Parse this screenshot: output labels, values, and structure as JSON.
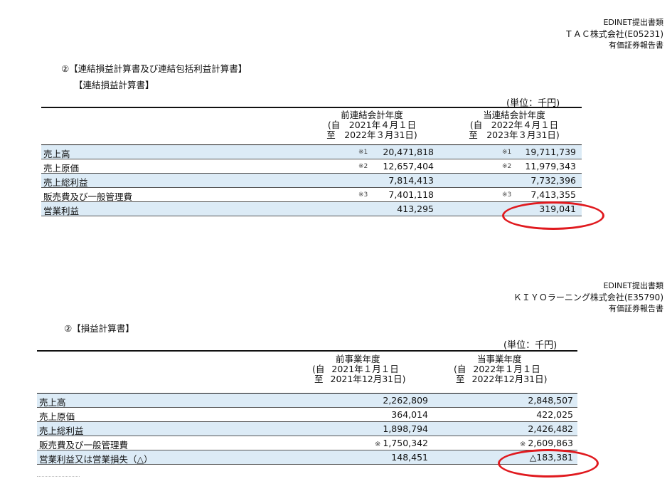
{
  "doc1": {
    "header": {
      "line1": "EDINET提出書類",
      "line2": "ＴＡＣ株式会社(E05231)",
      "line3": "有価証券報告書"
    },
    "section_title": "②【連結損益計算書及び連結包括利益計算書】",
    "sub_title": "【連結損益計算書】",
    "unit": "(単位：千円)",
    "col1": {
      "line1": "前連結会計年度",
      "line2": "(自　2021年４月１日",
      "line3": "至　2022年３月31日)"
    },
    "col2": {
      "line1": "当連結会計年度",
      "line2": "(自　2022年４月１日",
      "line3": "至　2023年３月31日)"
    },
    "rows": [
      {
        "label": "売上高",
        "mark1": "※1",
        "v1": "20,471,818",
        "mark2": "※1",
        "v2": "19,711,739"
      },
      {
        "label": "売上原価",
        "mark1": "※2",
        "v1": "12,657,404",
        "mark2": "※2",
        "v2": "11,979,343"
      },
      {
        "label": "売上総利益",
        "mark1": "",
        "v1": "7,814,413",
        "mark2": "",
        "v2": "7,732,396"
      },
      {
        "label": "販売費及び一般管理費",
        "mark1": "※3",
        "v1": "7,401,118",
        "mark2": "※3",
        "v2": "7,413,355"
      },
      {
        "label": "営業利益",
        "mark1": "",
        "v1": "413,295",
        "mark2": "",
        "v2": "319,041"
      }
    ]
  },
  "doc2": {
    "header": {
      "line1": "EDINET提出書類",
      "line2": "ＫＩＹＯラーニング株式会社(E35790)",
      "line3": "有価証券報告書"
    },
    "section_title": "②【損益計算書】",
    "unit": "(単位：千円)",
    "col1": {
      "line1": "前事業年度",
      "ji": "(自",
      "itaru": "至",
      "line2": "2021年１月１日",
      "line3": "2021年12月31日)"
    },
    "col2": {
      "line1": "当事業年度",
      "ji": "(自",
      "itaru": "至",
      "line2": "2022年１月１日",
      "line3": "2022年12月31日)"
    },
    "rows": [
      {
        "label": "売上高",
        "v1": "2,262,809",
        "v2": "2,848,507"
      },
      {
        "label": "売上原価",
        "v1": "364,014",
        "v2": "422,025"
      },
      {
        "label": "売上総利益",
        "v1": "1,898,794",
        "v2": "2,426,482"
      },
      {
        "label": "販売費及び一般管理費",
        "mark1": "※",
        "v1": "1,750,342",
        "mark2": "※",
        "v2": "2,609,863"
      },
      {
        "label": "営業利益又は営業損失（△）",
        "v1": "148,451",
        "v2": "△183,381"
      }
    ]
  }
}
